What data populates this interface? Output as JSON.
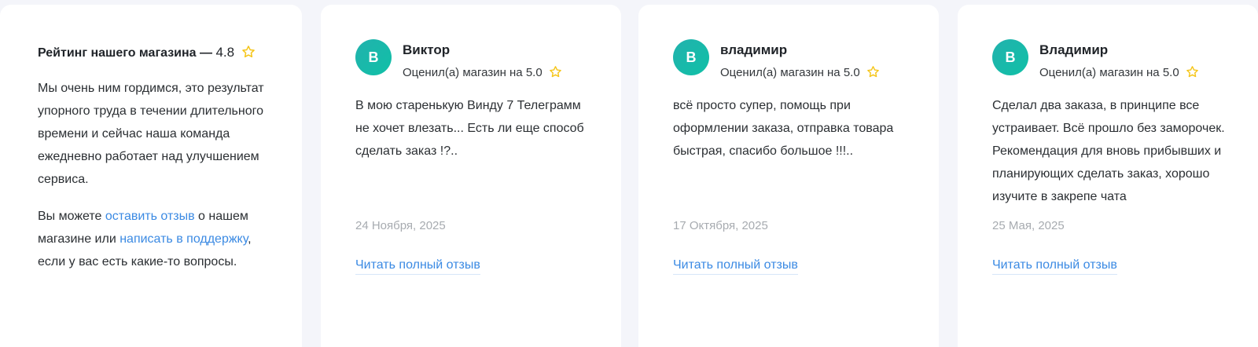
{
  "summary": {
    "rating_label": "Рейтинг нашего магазина —",
    "rating_value": "4.8",
    "intro_text": "Мы очень ним гордимся, это результат упорного труда в течении длительного времени и сейчас наша команда ежедневно работает над улучшением сервиса.",
    "cta_prefix": "Вы можете ",
    "leave_review_link": "оставить отзыв",
    "cta_middle": " о нашем магазине или ",
    "support_link": "написать в поддержку",
    "cta_suffix": ", если у вас есть какие-то вопросы."
  },
  "rated_prefix": "Оценил(а) магазин на",
  "read_more_label": "Читать полный отзыв",
  "colors": {
    "star": "#f5c518",
    "link": "#3b8ae3",
    "avatar": "#14b8a6"
  },
  "icons": {
    "star": "star-icon"
  },
  "reviews": [
    {
      "avatar_letter": "В",
      "author": "Виктор",
      "score": "5.0",
      "text": "В мою старенькую Винду 7 Телеграмм не хочет влезать... Есть ли еще способ сделать заказ !?..",
      "date": "24 Ноября, 2025"
    },
    {
      "avatar_letter": "В",
      "author": "владимир",
      "score": "5.0",
      "text": "всё просто супер, помощь при оформлении заказа, отправка товара быстрая, спасибо большое !!!..",
      "date": "17 Октября, 2025"
    },
    {
      "avatar_letter": "В",
      "author": "Владимир",
      "score": "5.0",
      "text": "Сделал два заказа, в принципе все устраивает. Всё прошло без заморочек. Рекомендация для вновь прибывших и планирующих сделать заказ, хорошо изучите в закрепе чата",
      "date": "25 Мая, 2025"
    }
  ]
}
